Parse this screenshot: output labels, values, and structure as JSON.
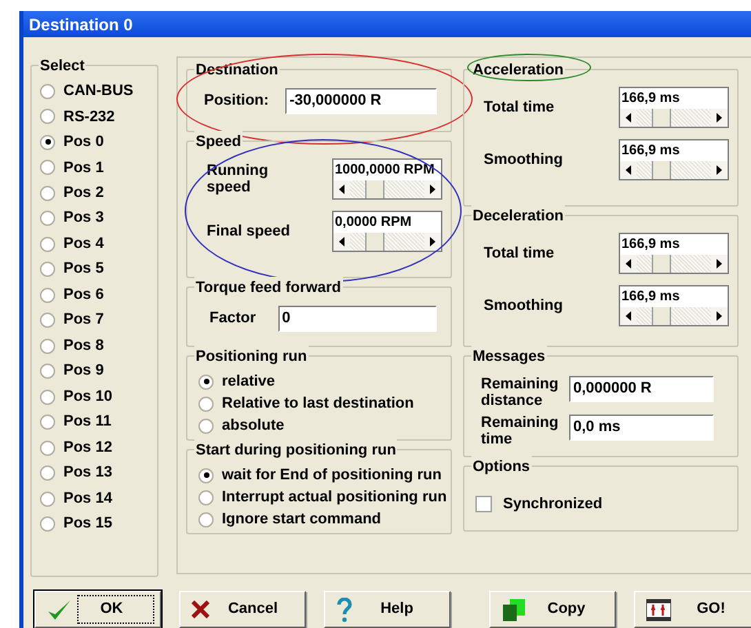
{
  "window": {
    "title": "Destination 0"
  },
  "select": {
    "title": "Select",
    "options": [
      {
        "label": "CAN-BUS",
        "selected": false
      },
      {
        "label": "RS-232",
        "selected": false
      },
      {
        "label": "Pos 0",
        "selected": true
      },
      {
        "label": "Pos 1",
        "selected": false
      },
      {
        "label": "Pos 2",
        "selected": false
      },
      {
        "label": "Pos 3",
        "selected": false
      },
      {
        "label": "Pos 4",
        "selected": false
      },
      {
        "label": "Pos 5",
        "selected": false
      },
      {
        "label": "Pos 6",
        "selected": false
      },
      {
        "label": "Pos 7",
        "selected": false
      },
      {
        "label": "Pos 8",
        "selected": false
      },
      {
        "label": "Pos 9",
        "selected": false
      },
      {
        "label": "Pos 10",
        "selected": false
      },
      {
        "label": "Pos 11",
        "selected": false
      },
      {
        "label": "Pos 12",
        "selected": false
      },
      {
        "label": "Pos 13",
        "selected": false
      },
      {
        "label": "Pos 14",
        "selected": false
      },
      {
        "label": "Pos 15",
        "selected": false
      }
    ]
  },
  "destination": {
    "title": "Destination",
    "label": "Position:",
    "value": "-30,000000 R"
  },
  "speed": {
    "title": "Speed",
    "rows": [
      {
        "label": "Running speed",
        "value": "1000,0000 RPM"
      },
      {
        "label": "Final speed",
        "value": "0,0000 RPM"
      }
    ]
  },
  "torque_feed_forward": {
    "title": "Torque feed forward",
    "label": "Factor",
    "value": "0"
  },
  "positioning_run": {
    "title": "Positioning run",
    "options": [
      {
        "label": "relative",
        "selected": true
      },
      {
        "label": "Relative to last destination",
        "selected": false
      },
      {
        "label": "absolute",
        "selected": false
      }
    ]
  },
  "start_during_positioning_run": {
    "title": "Start during positioning run",
    "options": [
      {
        "label": "wait for End of positioning run",
        "selected": true
      },
      {
        "label": "Interrupt actual positioning run",
        "selected": false
      },
      {
        "label": "Ignore start command",
        "selected": false
      }
    ]
  },
  "acceleration": {
    "title": "Acceleration",
    "rows": [
      {
        "label": "Total time",
        "value": "166,9 ms"
      },
      {
        "label": "Smoothing",
        "value": "166,9 ms"
      }
    ]
  },
  "deceleration": {
    "title": "Deceleration",
    "rows": [
      {
        "label": "Total time",
        "value": "166,9 ms"
      },
      {
        "label": "Smoothing",
        "value": "166,9 ms"
      }
    ]
  },
  "messages": {
    "title": "Messages",
    "rows": [
      {
        "label": "Remaining distance",
        "value": "0,000000 R"
      },
      {
        "label": "Remaining time",
        "value": "0,0 ms"
      }
    ]
  },
  "options": {
    "title": "Options",
    "checkboxes": [
      {
        "label": "Synchronized",
        "checked": false
      }
    ]
  },
  "buttons": [
    {
      "kind": "ok",
      "label": "OK",
      "focused": true
    },
    {
      "kind": "cancel",
      "label": "Cancel",
      "focused": false
    },
    {
      "kind": "help",
      "label": "Help",
      "focused": false
    },
    {
      "kind": "copy",
      "label": "Copy",
      "focused": false
    },
    {
      "kind": "go",
      "label": "GO!",
      "focused": false
    }
  ]
}
